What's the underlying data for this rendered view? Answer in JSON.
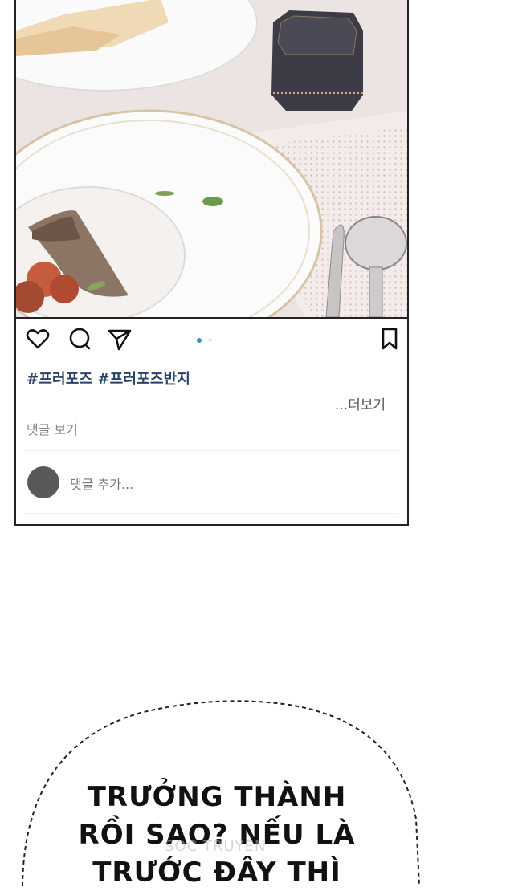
{
  "post": {
    "icons": {
      "like": "heart-icon",
      "comment": "comment-bubble-icon",
      "share": "paper-plane-icon",
      "save": "bookmark-icon"
    },
    "carousel": {
      "current": 1
    },
    "hashtags": [
      "#프러포즈",
      "#프러포즈반지"
    ],
    "more_label": "...더보기",
    "view_comments_label": "댓글 보기",
    "add_comment_placeholder": "댓글 추가..."
  },
  "speech_bubble": {
    "lines": [
      "TRƯỞNG THÀNH",
      "RỒI SAO? NẾU LÀ",
      "TRƯỚC ĐÂY THÌ"
    ]
  },
  "watermark": {
    "text": "SOC TRUYEN"
  },
  "colors": {
    "hashtag": "#2a4168",
    "carousel_dot": "#3a90c8",
    "avatar": "#595959"
  }
}
